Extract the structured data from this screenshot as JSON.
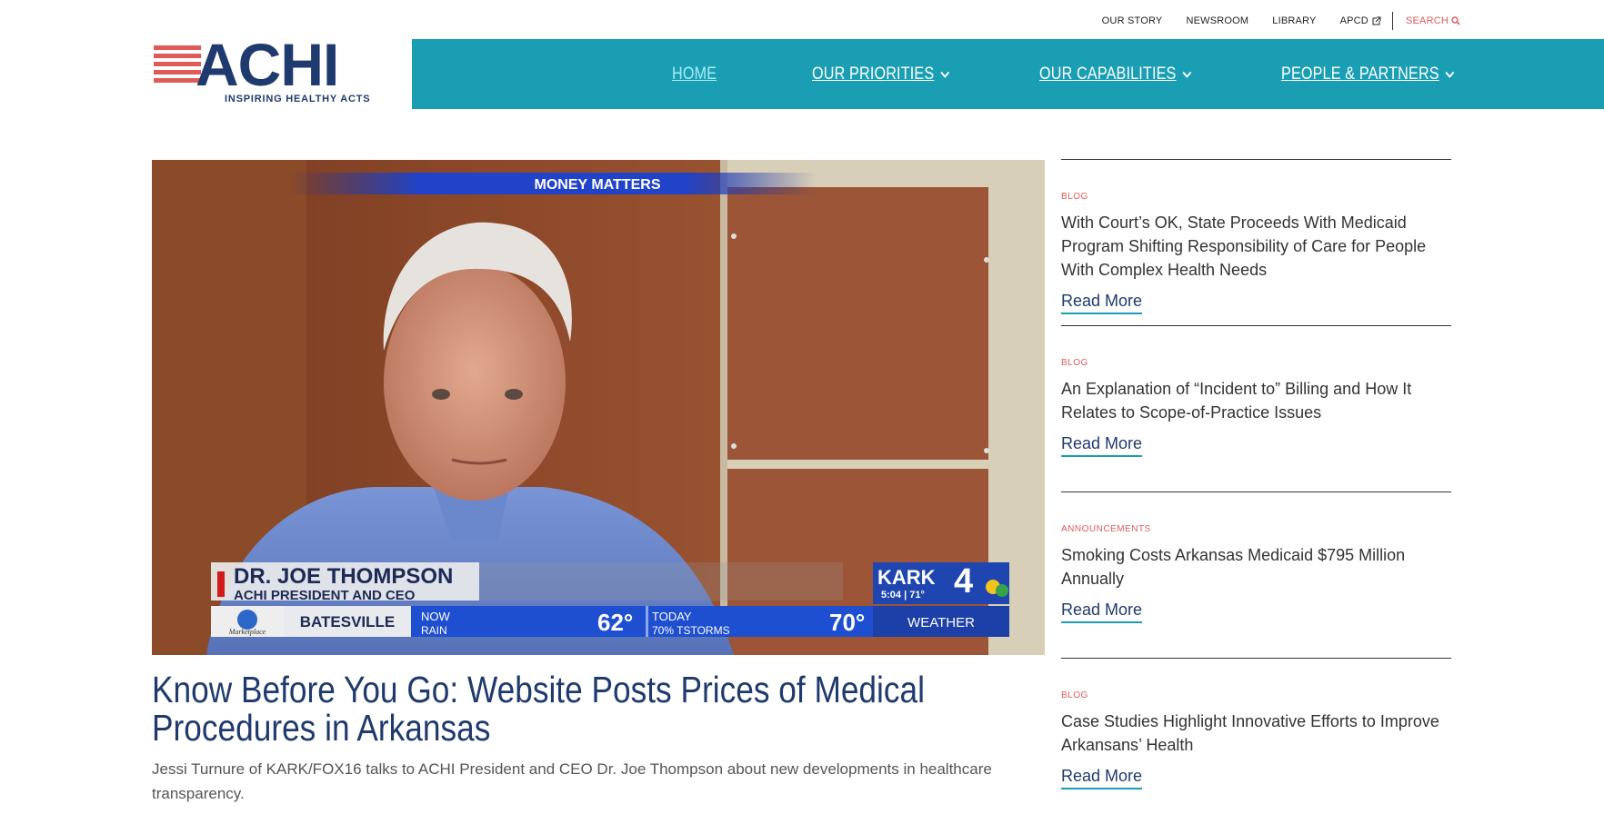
{
  "utility_nav": {
    "items": [
      "OUR STORY",
      "NEWSROOM",
      "LIBRARY",
      "APCD"
    ],
    "search_label": "SEARCH"
  },
  "logo": {
    "word": "ACHI",
    "tagline": "INSPIRING HEALTHY ACTS"
  },
  "main_nav": {
    "items": [
      {
        "label": "HOME",
        "active": true
      },
      {
        "label": "OUR PRIORITIES",
        "dropdown": true
      },
      {
        "label": "OUR CAPABILITIES",
        "dropdown": true
      },
      {
        "label": "PEOPLE & PARTNERS",
        "dropdown": true
      }
    ]
  },
  "feature": {
    "image": {
      "banner": "MONEY MATTERS",
      "lower_third_name": "DR. JOE THOMPSON",
      "lower_third_title": "ACHI PRESIDENT AND CEO",
      "sponsor": "Marketplace",
      "city": "BATESVILLE",
      "now_label": "NOW",
      "now_cond": "RAIN",
      "now_temp": "62°",
      "today_label": "TODAY",
      "today_cond": "70% TSTORMS",
      "today_temp": "70°",
      "station": "KARK",
      "station_num": "4",
      "time_temp": "5:04 | 71°",
      "weather_label": "WEATHER"
    },
    "title": "Know Before You Go: Website Posts Prices of Medical Procedures in Arkansas",
    "description": "Jessi Turnure of KARK/FOX16 talks to ACHI President and CEO Dr. Joe Thompson about new developments in healthcare transparency."
  },
  "posts": [
    {
      "category": "BLOG",
      "title": "With Court’s OK, State Proceeds With Medicaid Program Shifting Responsibility of Care for People With Complex Health Needs",
      "link": "Read More"
    },
    {
      "category": "BLOG",
      "title": "An Explanation of “Incident to” Billing and How It Relates to Scope-of-Practice Issues",
      "link": "Read More"
    },
    {
      "category": "ANNOUNCEMENTS",
      "title": "Smoking Costs Arkansas Medicaid $795 Million Annually",
      "link": "Read More"
    },
    {
      "category": "BLOG",
      "title": "Case Studies Highlight Innovative Efforts to Improve Arkansans’ Health",
      "link": "Read More"
    }
  ],
  "colors": {
    "brand_navy": "#1f3a6e",
    "brand_teal": "#1a9eb3",
    "accent_red": "#e05a5a"
  }
}
